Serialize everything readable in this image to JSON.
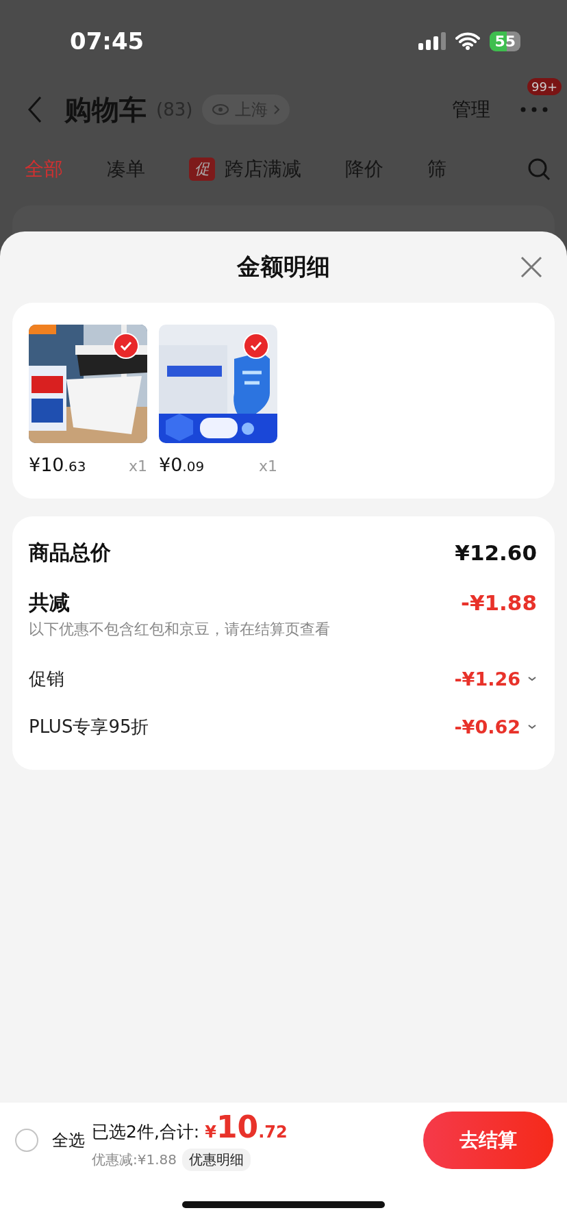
{
  "status_bar": {
    "time": "07:45",
    "battery": "55"
  },
  "nav": {
    "title": "购物车",
    "count": "(83)",
    "location": "上海",
    "manage": "管理",
    "badge": "99+"
  },
  "tabs": [
    {
      "label": "全部",
      "selected": true
    },
    {
      "label": "凑单",
      "selected": false
    },
    {
      "label": "跨店满减",
      "selected": false,
      "tag": "促"
    },
    {
      "label": "降价",
      "selected": false
    },
    {
      "label": "筛",
      "selected": false
    }
  ],
  "sheet": {
    "title": "金额明细",
    "products": [
      {
        "price_main": "¥10",
        "price_decimals": ".63",
        "qty": "x1",
        "checked": true,
        "kind": "broom"
      },
      {
        "price_main": "¥0",
        "price_decimals": ".09",
        "qty": "x1",
        "checked": true,
        "kind": "shield"
      }
    ],
    "summary": {
      "total_label": "商品总价",
      "total": "¥12.60",
      "discount_label": "共减",
      "discount": "-¥1.88",
      "note": "以下优惠不包含红包和京豆，请在结算页查看",
      "items": [
        {
          "label": "促销",
          "amount": "-¥1.26"
        },
        {
          "label": "PLUS专享95折",
          "amount": "-¥0.62"
        }
      ]
    }
  },
  "footer": {
    "select_all": {
      "label": "全选",
      "checked": false
    },
    "selected_text": "已选2件,合计:",
    "total_symbol": "¥",
    "total_main": "10",
    "total_decimals": ".72",
    "discount_text": "优惠减:¥1.88",
    "details_button": "优惠明细",
    "checkout": "去结算"
  }
}
